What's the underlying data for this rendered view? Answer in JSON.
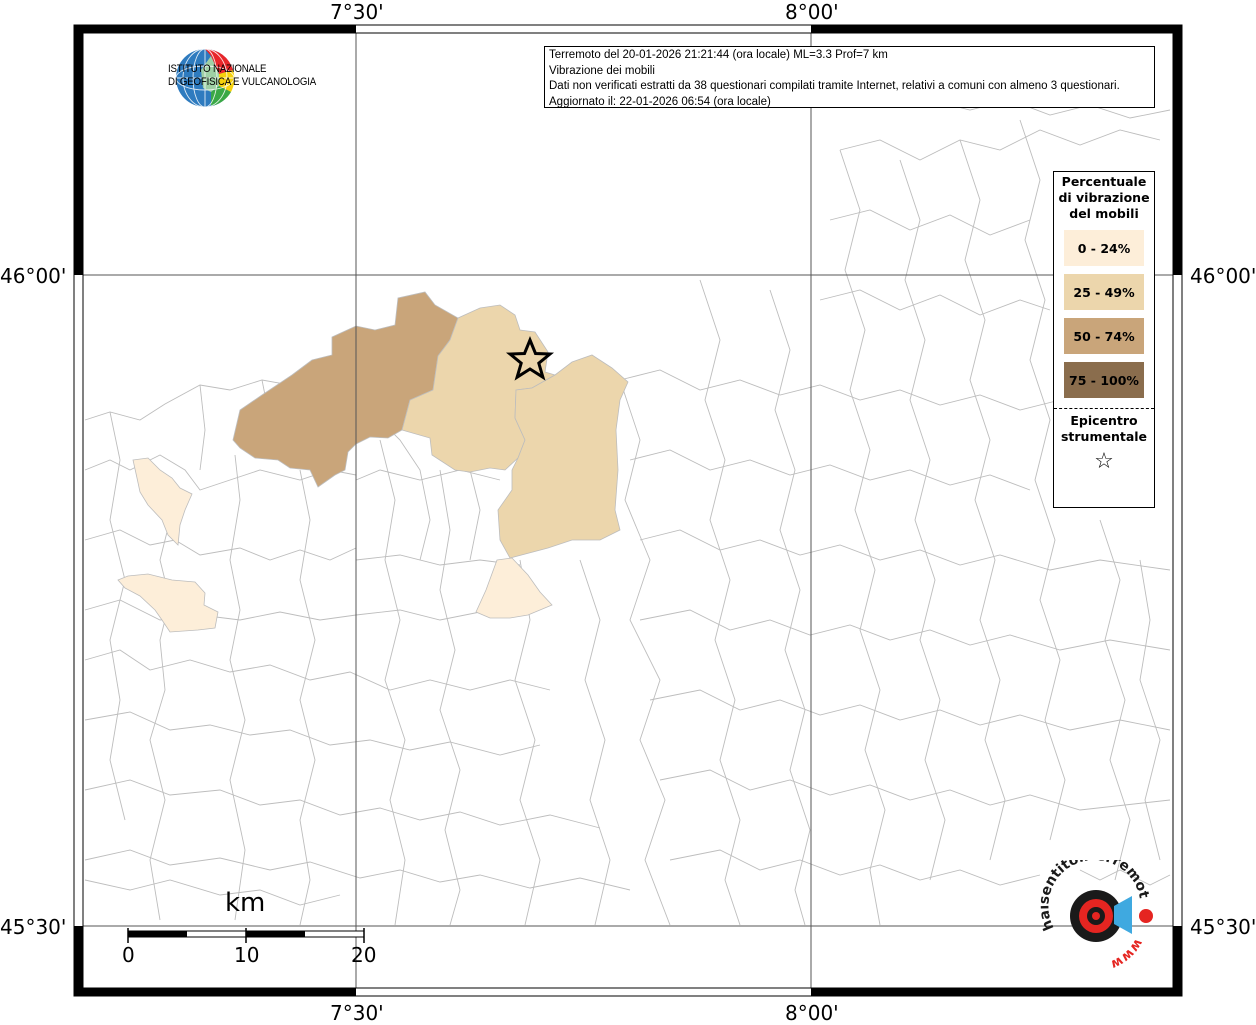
{
  "info": {
    "line1": "Terremoto del 20-01-2026 21:21:44 (ora locale) ML=3.3 Prof=7 km",
    "line2": "Vibrazione dei mobili",
    "line3": "Dati non verificati estratti da 38 questionari compilati tramite Internet, relativi a comuni con almeno 3 questionari.",
    "line4": "Aggiornato il: 22-01-2026 06:54 (ora locale)"
  },
  "institute": {
    "line1": "ISTITUTO NAZIONALE",
    "line2": "DI GEOFISICA E VULCANOLOGIA"
  },
  "axes": {
    "lon_left": "7°30'",
    "lon_right": "8°00'",
    "lat_top": "46°00'",
    "lat_bottom": "45°30'"
  },
  "legend": {
    "title": "Percentuale di vibrazione del mobili",
    "classes": [
      {
        "label": "0 - 24%",
        "color": "#fdeed9"
      },
      {
        "label": "25 - 49%",
        "color": "#ecd6ac"
      },
      {
        "label": "50 - 74%",
        "color": "#c9a57a"
      },
      {
        "label": "75 - 100%",
        "color": "#8a6d4d"
      }
    ],
    "epicenter_label": "Epicentro strumentale",
    "epicenter_icon": "star-icon"
  },
  "scale": {
    "unit": "km",
    "ticks": [
      "0",
      "10",
      "20"
    ]
  },
  "logo": {
    "text": "haisentitoilterremoto.it",
    "url": "www"
  }
}
